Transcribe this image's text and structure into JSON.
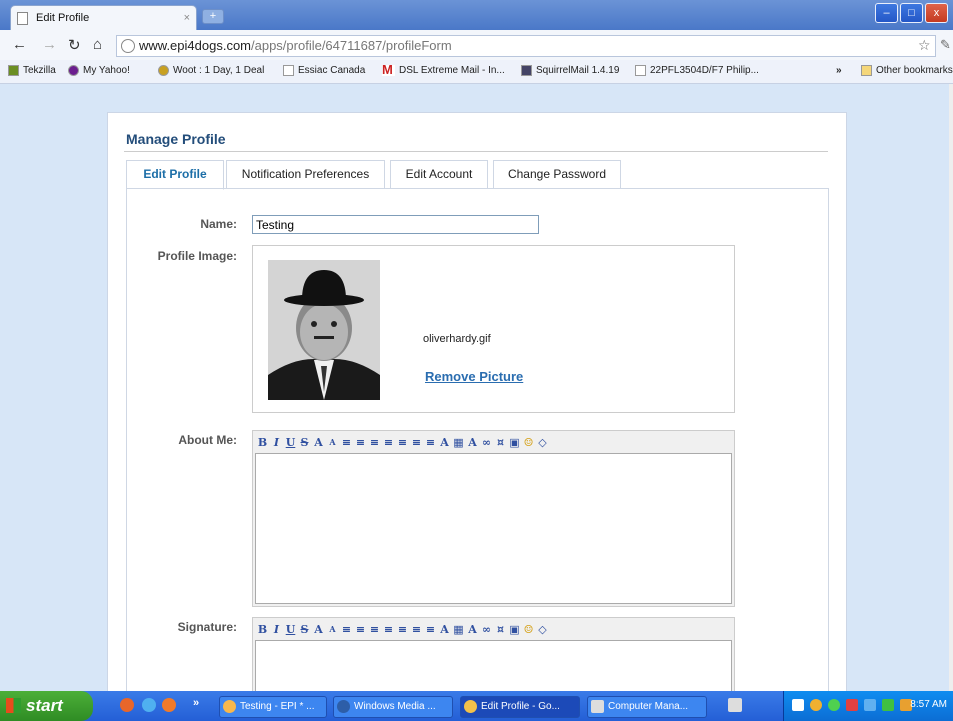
{
  "browser": {
    "tab_title": "Edit Profile",
    "tab_close": "×",
    "new_tab": "+",
    "url_host": "www.epi4dogs.com",
    "url_path": "/apps/profile/64711687/profileForm",
    "window_controls": [
      "–",
      "□",
      "x"
    ],
    "overflow": "»"
  },
  "bookmarks": [
    {
      "label": "Tekzilla"
    },
    {
      "label": "My Yahoo!"
    },
    {
      "label": "Woot : 1 Day, 1 Deal"
    },
    {
      "label": "Essiac Canada"
    },
    {
      "label": "DSL Extreme Mail - In..."
    },
    {
      "label": "SquirrelMail 1.4.19"
    },
    {
      "label": "22PFL3504D/F7 Philip..."
    },
    {
      "label": "Other bookmarks"
    }
  ],
  "page": {
    "title": "Manage Profile",
    "tabs": [
      {
        "label": "Edit Profile",
        "active": true
      },
      {
        "label": "Notification Preferences"
      },
      {
        "label": "Edit Account"
      },
      {
        "label": "Change Password"
      }
    ],
    "form": {
      "name_label": "Name:",
      "name_value": "Testing",
      "profile_image_label": "Profile Image:",
      "image_filename": "oliverhardy.gif",
      "remove_picture": "Remove Picture",
      "about_label": "About Me:",
      "signature_label": "Signature:"
    }
  },
  "taskbar": {
    "start": "start",
    "items": [
      {
        "label": "Testing - EPI * ..."
      },
      {
        "label": "Windows Media ..."
      },
      {
        "label": "Edit Profile - Go...",
        "active": true
      },
      {
        "label": "Computer Mana..."
      }
    ],
    "clock": "8:57 AM"
  }
}
